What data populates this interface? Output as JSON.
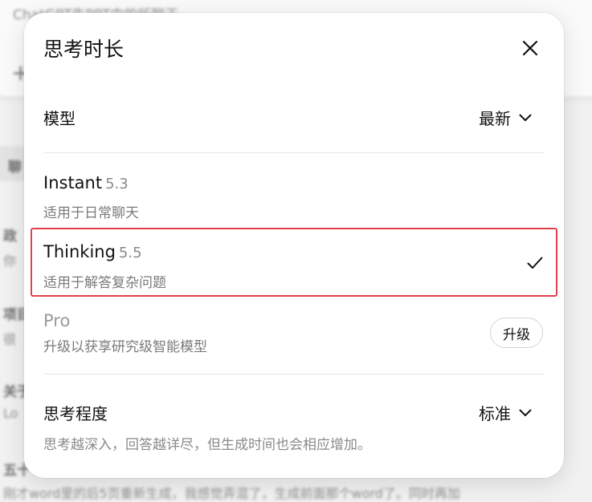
{
  "background": {
    "top_title": "ChatGPT生PPT中的所聊天",
    "chip_label": "聊",
    "items": [
      {
        "line1": "政",
        "line2": "你"
      },
      {
        "line1": "项目",
        "line2": "很"
      },
      {
        "line1": "关于",
        "line2": "Lo"
      },
      {
        "line1": "五十",
        "line2": "刚才word里的后5页重新生成，我感觉弄混了，生成前面那个word了。同时再加"
      }
    ]
  },
  "modal": {
    "title": "思考时长",
    "close_icon": "close-icon",
    "model_label": "模型",
    "model_value": "最新",
    "options": [
      {
        "name": "Instant",
        "version": "5.3",
        "desc": "适用于日常聊天",
        "selected": false
      },
      {
        "name": "Thinking",
        "version": "5.5",
        "desc": "适用于解答复杂问题",
        "selected": true
      },
      {
        "name": "Pro",
        "version": "",
        "desc": "升级以获享研究级智能模型",
        "selected": false
      }
    ],
    "upgrade_label": "升级",
    "effort_label": "思考程度",
    "effort_value": "标准",
    "effort_help": "思考越深入，回答越详尽，但生成时间也会相应增加。"
  },
  "colors": {
    "highlight_border": "#e2414b",
    "text_primary": "#111111",
    "text_secondary": "#7a7a7a"
  }
}
